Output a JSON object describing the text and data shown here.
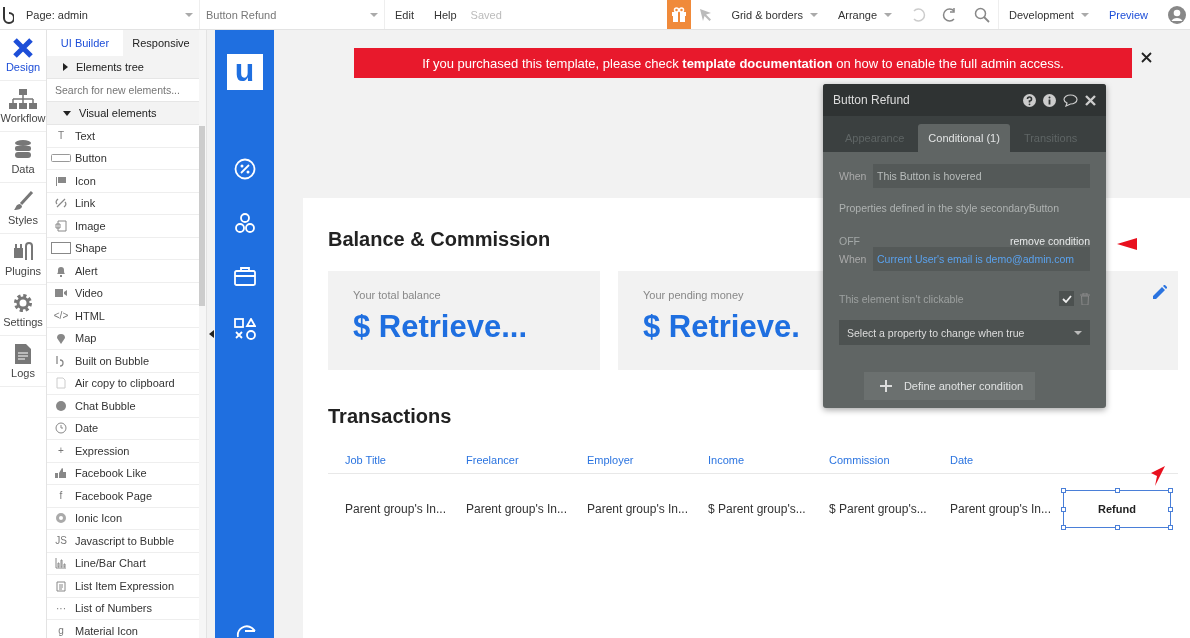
{
  "topbar": {
    "page_select": "Page: admin",
    "element_select": "Button Refund",
    "menu": [
      "Edit",
      "Help"
    ],
    "save_status": "Saved",
    "grid_menu": "Grid & borders",
    "arrange_menu": "Arrange",
    "mode_select": "Development",
    "preview": "Preview"
  },
  "rail": [
    {
      "label": "Design",
      "selected": true
    },
    {
      "label": "Workflow",
      "selected": false
    },
    {
      "label": "Data",
      "selected": false
    },
    {
      "label": "Styles",
      "selected": false
    },
    {
      "label": "Plugins",
      "selected": false
    },
    {
      "label": "Settings",
      "selected": false
    },
    {
      "label": "Logs",
      "selected": false
    }
  ],
  "panel": {
    "tabs": [
      {
        "label": "UI Builder",
        "selected": true
      },
      {
        "label": "Responsive",
        "selected": false
      }
    ],
    "elements_tree": {
      "label": "Elements tree",
      "expanded": false
    },
    "search": {
      "placeholder": "Search for new elements..."
    },
    "visual_elements": {
      "label": "Visual elements",
      "expanded": true,
      "items": [
        {
          "label": "Text",
          "glyph": "T"
        },
        {
          "label": "Button"
        },
        {
          "label": "Icon"
        },
        {
          "label": "Link"
        },
        {
          "label": "Image"
        },
        {
          "label": "Shape"
        },
        {
          "label": "Alert"
        },
        {
          "label": "Video"
        },
        {
          "label": "HTML",
          "glyph": "</>"
        },
        {
          "label": "Map"
        },
        {
          "label": "Built on Bubble"
        },
        {
          "label": "Air copy to clipboard"
        },
        {
          "label": "Chat Bubble"
        },
        {
          "label": "Date"
        },
        {
          "label": "Expression",
          "glyph": "+"
        },
        {
          "label": "Facebook Like"
        },
        {
          "label": "Facebook Page",
          "glyph": "f"
        },
        {
          "label": "Ionic Icon"
        },
        {
          "label": "Javascript to Bubble",
          "glyph": "JS"
        },
        {
          "label": "Line/Bar Chart"
        },
        {
          "label": "List Item Expression"
        },
        {
          "label": "List of Numbers",
          "glyph": "···"
        },
        {
          "label": "Material Icon",
          "glyph": "g"
        }
      ]
    }
  },
  "canvas": {
    "app_logo": "u",
    "banner": "If you purchased this template, please check **template documentation** on how to enable the full admin access.",
    "balance": {
      "title": "Balance & Commission",
      "cards": [
        {
          "label": "Your total balance",
          "value": "$ Retrieve..."
        },
        {
          "label": "Your pending money",
          "value": "$ Retrieve."
        }
      ]
    },
    "transactions": {
      "title": "Transactions",
      "columns": [
        "Job Title",
        "Freelancer",
        "Employer",
        "Income",
        "Commission",
        "Date"
      ],
      "rows": [
        {
          "cells": [
            "Parent group's In...",
            "Parent group's In...",
            "Parent group's In...",
            "$ Parent group's...",
            "$ Parent group's...",
            "Parent group's In..."
          ],
          "action": "Refund",
          "selected": true
        }
      ]
    }
  },
  "property_editor": {
    "title": "Button Refund",
    "tabs": [
      {
        "label": "Appearance",
        "selected": false
      },
      {
        "label": "Conditional (1)",
        "selected": true
      },
      {
        "label": "Transitions",
        "selected": false
      }
    ],
    "first_condition": {
      "when_label": "When",
      "expression": "This Button is hovered",
      "note": "Properties defined in the style secondaryButton"
    },
    "second_condition": {
      "status": "OFF",
      "remove": "remove condition",
      "when_label": "When",
      "expression": "Current User's email is demo@admin.com",
      "properties": [
        {
          "label": "This element isn't clickable",
          "checked": true
        }
      ],
      "property_select": "Select a property to change when true"
    },
    "add_button": "Define another condition"
  }
}
